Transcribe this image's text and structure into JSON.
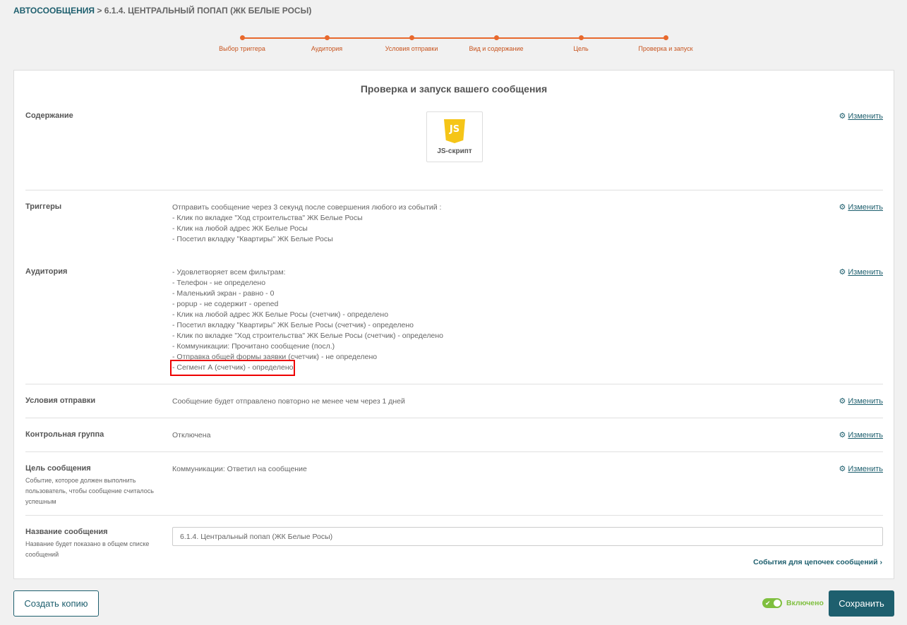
{
  "breadcrumb": {
    "root": "АВТОСООБЩЕНИЯ",
    "separator": ">",
    "current": "6.1.4. ЦЕНТРАЛЬНЫЙ ПОПАП (ЖК БЕЛЫЕ РОСЫ)"
  },
  "steps": [
    "Выбор триггера",
    "Аудитория",
    "Условия отправки",
    "Вид и содержание",
    "Цель",
    "Проверка и запуск"
  ],
  "colors": {
    "accent": "#e8692d",
    "primary": "#1e5f6e",
    "toggle_on": "#7fbf3f",
    "highlight": "#e00000"
  },
  "card_title": "Проверка и запуск вашего сообщения",
  "edit_label": "Изменить",
  "content": {
    "label": "Содержание",
    "tile_icon": "JS",
    "tile_label": "JS-скрипт"
  },
  "triggers": {
    "label": "Триггеры",
    "value": "Отправить сообщение через 3 секунд после совершения любого из событий :\n- Клик по вкладке \"Ход строительства\" ЖК Белые Росы\n- Клик на любой адрес ЖК Белые Росы\n- Посетил вкладку \"Квартиры\" ЖК Белые Росы"
  },
  "audience": {
    "label": "Аудитория",
    "value": "- Удовлетворяет всем фильтрам:\n- Телефон - не определено\n- Маленький экран - равно - 0\n- popup - не содержит - opened\n- Клик на любой адрес ЖК Белые Росы (счетчик) - определено\n- Посетил вкладку \"Квартиры\" ЖК Белые Росы (счетчик) - определено\n- Клик по вкладке \"Ход строительства\" ЖК Белые Росы (счетчик) - определено\n- Коммуникации: Прочитано сообщение (посл.)\n- Отправка общей формы заявки (счетчик) - не определено\n- Сегмент А (счетчик) - определено"
  },
  "send_conditions": {
    "label": "Условия отправки",
    "value": "Сообщение будет отправлено повторно не менее чем через 1 дней"
  },
  "control_group": {
    "label": "Контрольная группа",
    "value": "Отключена"
  },
  "goal": {
    "label": "Цель сообщения",
    "sub": "Событие, которое должен выполнить пользователь, чтобы сообщение считалось успешным",
    "value": "Коммуникации: Ответил на сообщение"
  },
  "name": {
    "label": "Название сообщения",
    "sub": "Название будет показано в общем списке сообщений",
    "value": "6.1.4. Центральный попап (ЖК Белые Росы)"
  },
  "chain_link": "События для цепочек сообщений ›",
  "footer": {
    "copy_button": "Создать копию",
    "toggle_label": "Включено",
    "toggle_state": "on",
    "save_button": "Сохранить"
  }
}
